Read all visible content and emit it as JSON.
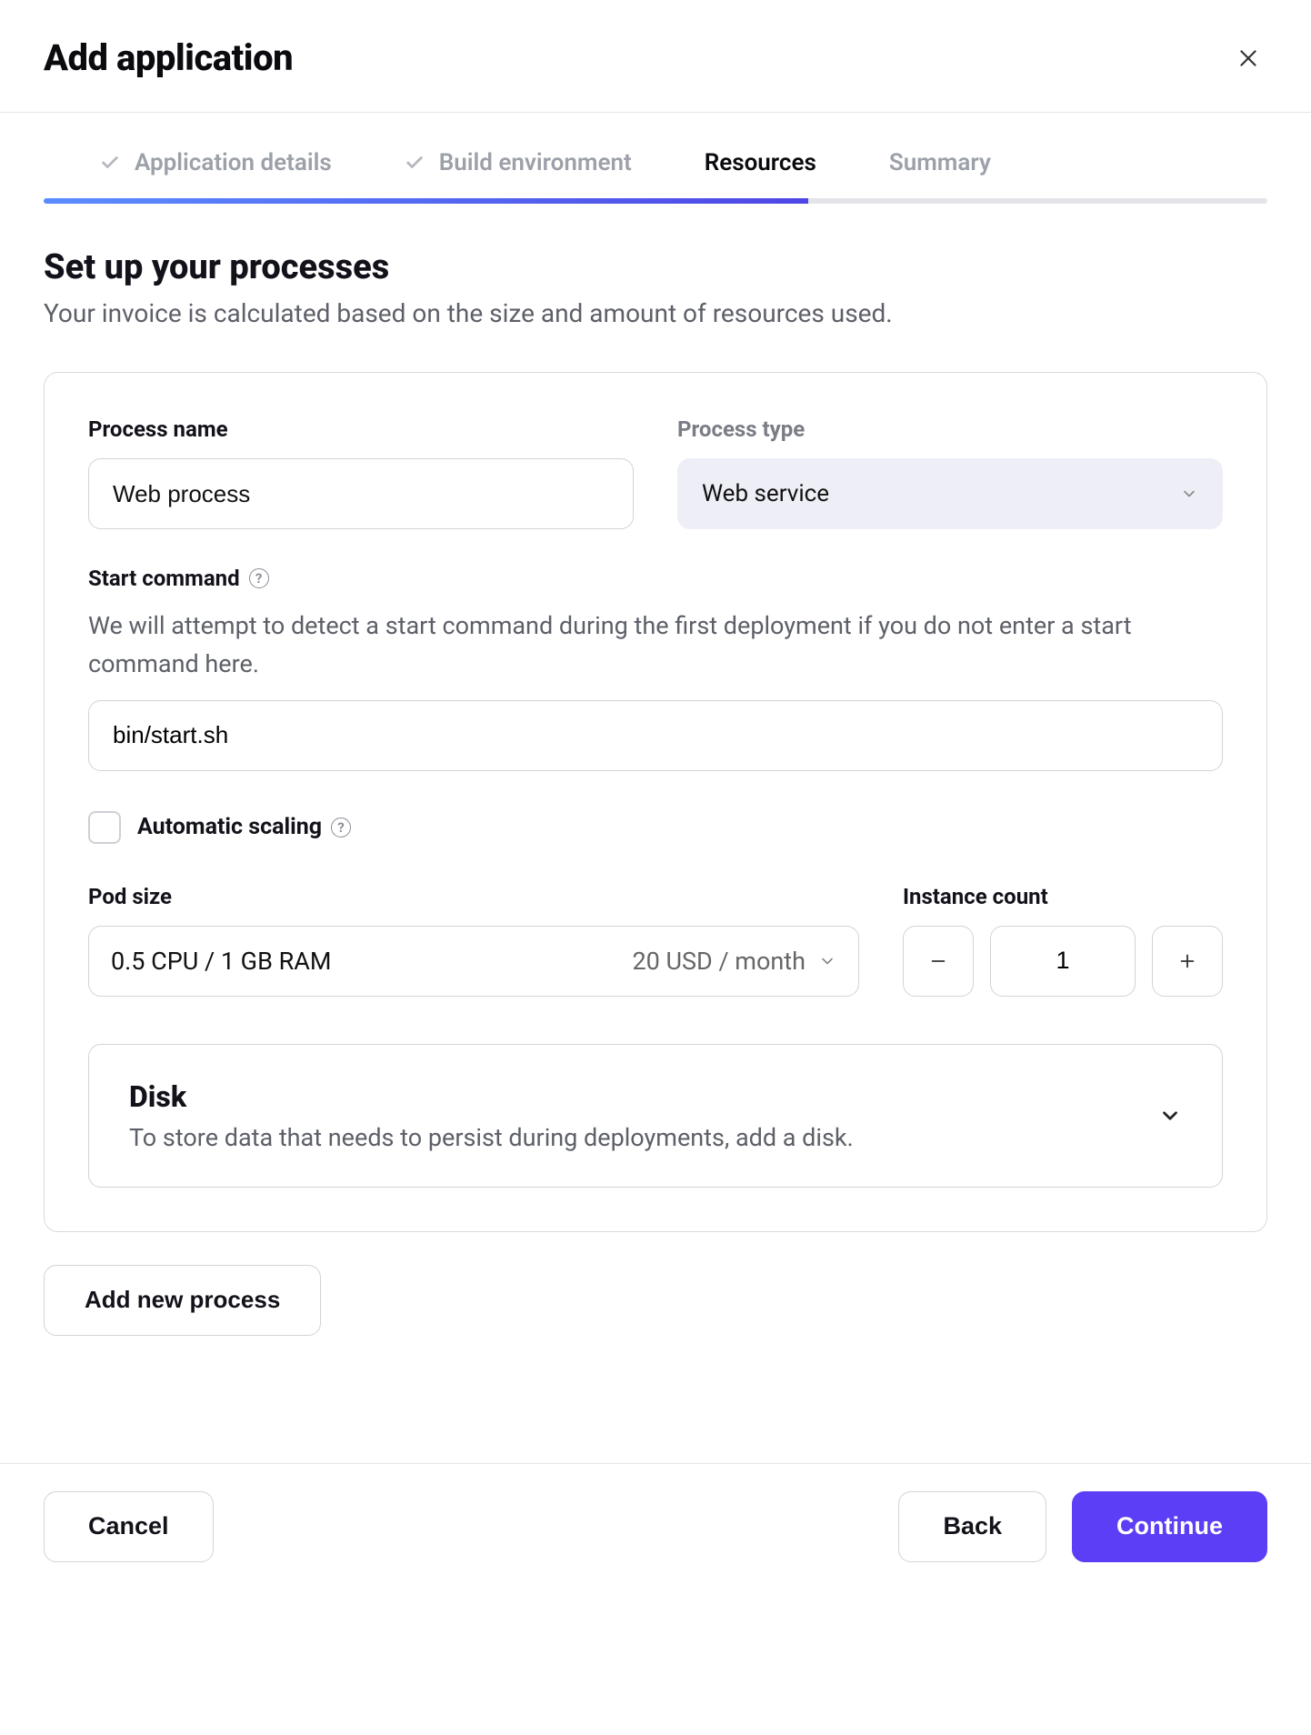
{
  "header": {
    "title": "Add application"
  },
  "stepper": {
    "steps": [
      {
        "label": "Application details",
        "completed": true,
        "active": false
      },
      {
        "label": "Build environment",
        "completed": true,
        "active": false
      },
      {
        "label": "Resources",
        "completed": false,
        "active": true
      },
      {
        "label": "Summary",
        "completed": false,
        "active": false
      }
    ],
    "progress_percent": 62.5
  },
  "section": {
    "title": "Set up your processes",
    "description": "Your invoice is calculated based on the size and amount of resources used."
  },
  "process": {
    "name_label": "Process name",
    "name_value": "Web process",
    "type_label": "Process type",
    "type_value": "Web service",
    "start_command_label": "Start command",
    "start_command_help": "We will attempt to detect a start command during the first deployment if you do not enter a start command here.",
    "start_command_value": "bin/start.sh",
    "auto_scaling_label": "Automatic scaling",
    "auto_scaling_checked": false,
    "pod_size_label": "Pod size",
    "pod_size_value": "0.5 CPU / 1 GB RAM",
    "pod_size_price": "20 USD / month",
    "instance_count_label": "Instance count",
    "instance_count_value": "1",
    "disk_title": "Disk",
    "disk_description": "To store data that needs to persist during deployments, add a disk."
  },
  "buttons": {
    "add_process": "Add new process",
    "cancel": "Cancel",
    "back": "Back",
    "continue": "Continue"
  }
}
